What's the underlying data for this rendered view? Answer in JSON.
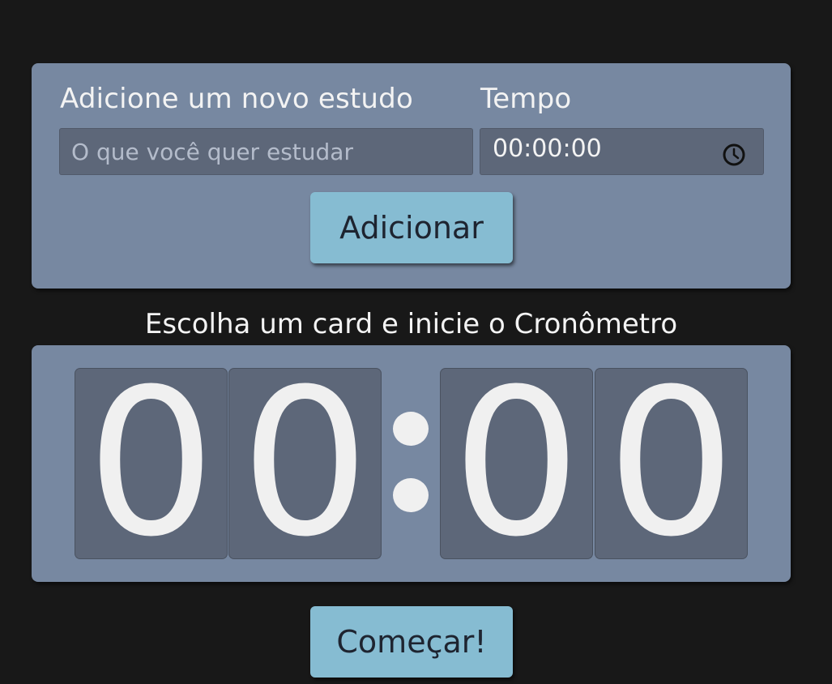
{
  "form": {
    "study_label": "Adicione um novo estudo",
    "time_label": "Tempo",
    "study_placeholder": "O que você quer estudar",
    "time_value": "00:00:00",
    "add_button": "Adicionar"
  },
  "timer": {
    "instruction": "Escolha um card e inicie o Cronômetro",
    "digits": [
      "0",
      "0",
      "0",
      "0"
    ],
    "start_button": "Começar!"
  },
  "colors": {
    "background": "#181818",
    "panel": "#7788a1",
    "field": "#5d6779",
    "button": "#86bcd2"
  },
  "icons": {
    "time_field": "clock-icon"
  }
}
